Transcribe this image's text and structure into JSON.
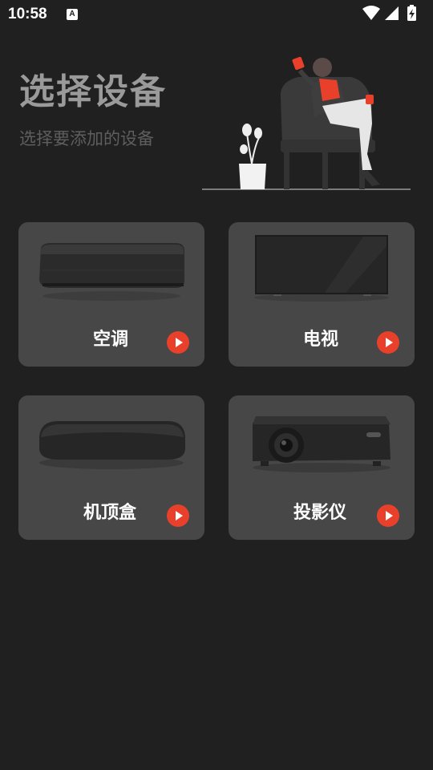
{
  "status_bar": {
    "time": "10:58",
    "a_icon": "A"
  },
  "header": {
    "title": "选择设备",
    "subtitle": "选择要添加的设备"
  },
  "devices": [
    {
      "label": "空调",
      "icon": "air-conditioner-image"
    },
    {
      "label": "电视",
      "icon": "tv-image"
    },
    {
      "label": "机顶盒",
      "icon": "set-top-box-image"
    },
    {
      "label": "投影仪",
      "icon": "projector-image"
    }
  ],
  "colors": {
    "background": "#202021",
    "card": "#474747",
    "accent": "#e8402b",
    "title": "#9a9a9a",
    "subtitle": "#5e5e5e"
  }
}
